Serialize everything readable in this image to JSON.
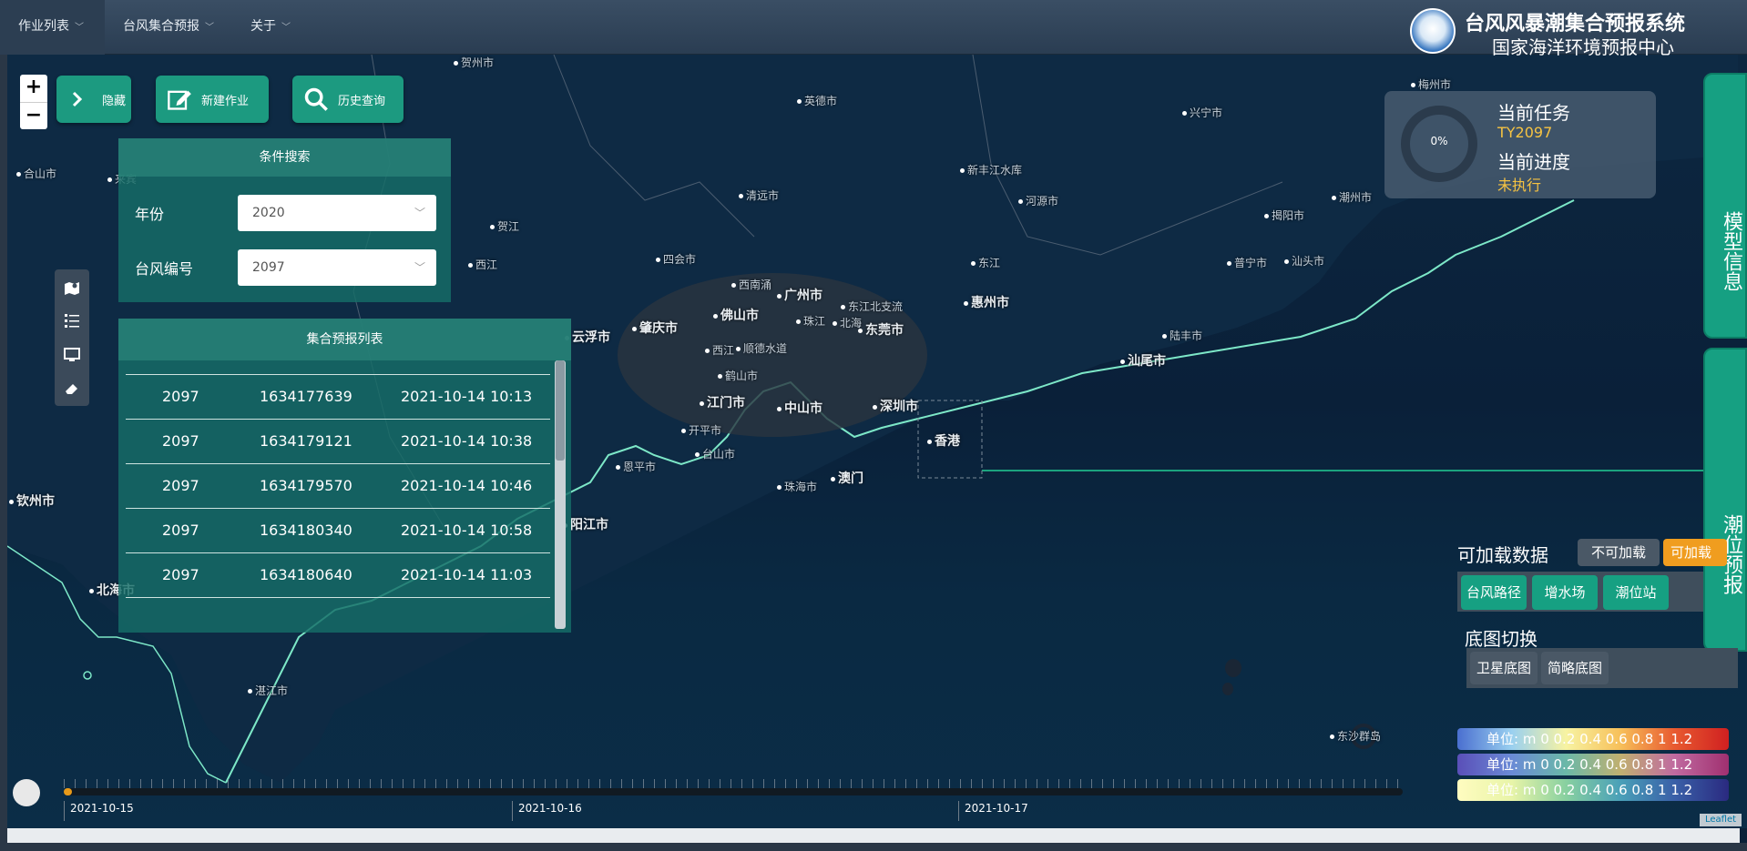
{
  "header": {
    "menus": [
      {
        "label": "作业列表"
      },
      {
        "label": "台风集合预报"
      },
      {
        "label": "关于"
      }
    ],
    "brand_title": "台风风暴潮集合预报系统",
    "brand_subtitle": "国家海洋环境预报中心"
  },
  "toolbar": {
    "zoom_in": "+",
    "zoom_out": "−",
    "hide_label": "隐藏",
    "new_job_label": "新建作业",
    "history_label": "历史查询"
  },
  "search": {
    "title": "条件搜索",
    "year_label": "年份",
    "year_value": "2020",
    "typhoon_label": "台风编号",
    "typhoon_value": "2097"
  },
  "forecast_list": {
    "title": "集合预报列表",
    "rows": [
      {
        "id": "2097",
        "code": "1634177639",
        "time": "2021-10-14 10:13"
      },
      {
        "id": "2097",
        "code": "1634179121",
        "time": "2021-10-14 10:38"
      },
      {
        "id": "2097",
        "code": "1634179570",
        "time": "2021-10-14 10:46"
      },
      {
        "id": "2097",
        "code": "1634180340",
        "time": "2021-10-14 10:58"
      },
      {
        "id": "2097",
        "code": "1634180640",
        "time": "2021-10-14 11:03"
      }
    ]
  },
  "task": {
    "progress_text": "0%",
    "progress_value": 0,
    "current_task_label": "当前任务",
    "current_task_value": "TY2097",
    "current_progress_label": "当前进度",
    "current_progress_value": "未执行"
  },
  "right_tabs": {
    "model_info": "模型信息",
    "tide_forecast": "潮位预报"
  },
  "data_load": {
    "title": "可加载数据",
    "not_loadable": "不可加载",
    "loadable": "可加载",
    "items": [
      "台风路径",
      "增水场",
      "潮位站"
    ]
  },
  "basemap": {
    "title": "底图切换",
    "items": [
      "卫星底图",
      "简略底图"
    ]
  },
  "legends": [
    {
      "text": "单位: m  0  0.2  0.4  0.6  0.8  1  1.2"
    },
    {
      "text": "单位: m  0  0.2  0.4  0.6  0.8  1  1.2"
    },
    {
      "text": "单位: m  0  0.2  0.4  0.6  0.8  1  1.2"
    }
  ],
  "timeline": {
    "dates": [
      "2021-10-15",
      "2021-10-16",
      "2021-10-17"
    ],
    "progress": 0.006
  },
  "map": {
    "attribution": "Leaflet",
    "cities": [
      {
        "name": "贺州市",
        "big": false
      },
      {
        "name": "英德市",
        "big": false
      },
      {
        "name": "梅州市",
        "big": false
      },
      {
        "name": "兴宁市",
        "big": false
      },
      {
        "name": "新丰江水库",
        "big": false
      },
      {
        "name": "清远市",
        "big": false
      },
      {
        "name": "河源市",
        "big": false
      },
      {
        "name": "揭阳市",
        "big": false
      },
      {
        "name": "潮州市",
        "big": false
      },
      {
        "name": "汕头市",
        "big": false
      },
      {
        "name": "普宁市",
        "big": false
      },
      {
        "name": "四会市",
        "big": false
      },
      {
        "name": "西南涌",
        "big": false
      },
      {
        "name": "广州市",
        "big": true
      },
      {
        "name": "东江北支流",
        "big": false
      },
      {
        "name": "东江",
        "big": false
      },
      {
        "name": "惠州市",
        "big": true
      },
      {
        "name": "肇庆市",
        "big": true
      },
      {
        "name": "佛山市",
        "big": true
      },
      {
        "name": "珠江",
        "big": false
      },
      {
        "name": "北海",
        "big": false
      },
      {
        "name": "东莞市",
        "big": true
      },
      {
        "name": "云浮市",
        "big": true
      },
      {
        "name": "顺德水道",
        "big": false
      },
      {
        "name": "西江",
        "big": false
      },
      {
        "name": "陆丰市",
        "big": false
      },
      {
        "name": "汕尾市",
        "big": true
      },
      {
        "name": "鹤山市",
        "big": false
      },
      {
        "name": "江门市",
        "big": true
      },
      {
        "name": "中山市",
        "big": true
      },
      {
        "name": "深圳市",
        "big": true
      },
      {
        "name": "开平市",
        "big": false
      },
      {
        "name": "台山市",
        "big": false
      },
      {
        "name": "香港",
        "big": true
      },
      {
        "name": "恩平市",
        "big": false
      },
      {
        "name": "珠海市",
        "big": false
      },
      {
        "name": "澳门",
        "big": true
      },
      {
        "name": "阳江市",
        "big": true
      },
      {
        "name": "钦州市",
        "big": true
      },
      {
        "name": "北海市",
        "big": true
      },
      {
        "name": "湛江市",
        "big": false
      },
      {
        "name": "合山市",
        "big": false
      },
      {
        "name": "来宾",
        "big": false
      },
      {
        "name": "贺江",
        "big": false
      },
      {
        "name": "西江",
        "big": false
      },
      {
        "name": "东沙群岛",
        "big": false
      }
    ]
  }
}
